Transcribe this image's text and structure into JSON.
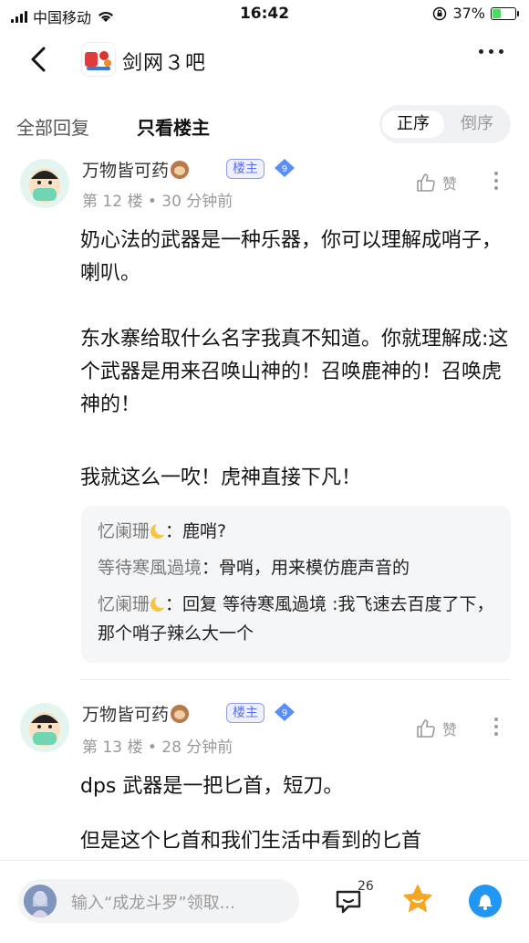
{
  "status_bar": {
    "carrier": "中国移动",
    "time": "16:42",
    "battery": "37%"
  },
  "nav": {
    "forum_name": "剑网３吧"
  },
  "tabs": {
    "all_replies": "全部回复",
    "only_owner": "只看楼主",
    "order_asc": "正序",
    "order_desc": "倒序"
  },
  "posts": [
    {
      "username": "万物皆可药",
      "owner_badge": "楼主",
      "level": "9",
      "meta": "第 12 楼 • 30 分钟前",
      "like_label": "赞",
      "paragraphs": [
        "奶心法的武器是一种乐器，你可以理解成哨子，喇叭。",
        "东水寨给取什么名字我真不知道。你就理解成:这个武器是用来召唤山神的！召唤鹿神的！召唤虎神的！",
        "我就这么一吹！虎神直接下凡！"
      ],
      "comments": [
        {
          "who": "忆阑珊",
          "moon": true,
          "text": "：鹿哨?"
        },
        {
          "who": "等待寒風過境",
          "moon": false,
          "text": "：骨哨，用来模仿鹿声音的"
        },
        {
          "who": "忆阑珊",
          "moon": true,
          "text": "：回复 等待寒風過境 :我飞速去百度了下，那个哨子辣么大一个"
        }
      ]
    },
    {
      "username": "万物皆可药",
      "owner_badge": "楼主",
      "level": "9",
      "meta": "第 13 楼 • 28 分钟前",
      "like_label": "赞",
      "paragraphs": [
        "dps 武器是一把匕首，短刀。",
        "但是这个匕首和我们生活中看到的匕首"
      ]
    }
  ],
  "bottom_bar": {
    "input_placeholder": "输入“成龙斗罗”领取...",
    "comment_count": "26"
  },
  "colors": {
    "accent": "#2196f3",
    "badge": "#5a6ff0",
    "star": "#f5a623"
  }
}
